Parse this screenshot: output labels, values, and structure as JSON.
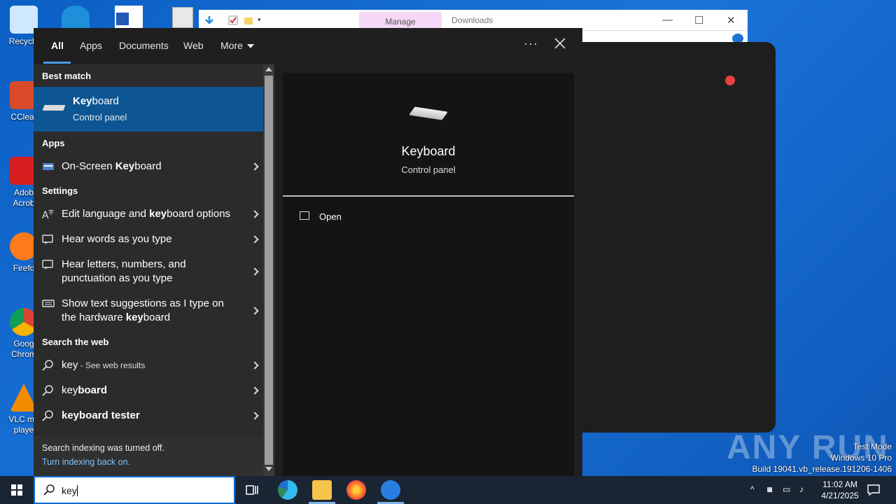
{
  "desktop": {
    "icons": [
      {
        "label": "Recycle",
        "color": "#9fd4ff"
      },
      {
        "label": "CClear",
        "color": "#d84a2a"
      },
      {
        "label": "Adob\nAcrob",
        "color": "#d81f1f"
      },
      {
        "label": "Firefo",
        "color": "#ff7a1a"
      },
      {
        "label": "Goog\nChrom",
        "color": "#2fa84f"
      },
      {
        "label": "VLC me\nplaye",
        "color": "#f28b00"
      }
    ]
  },
  "explorer": {
    "manage_label": "Manage",
    "location": "Downloads"
  },
  "search": {
    "tabs": [
      {
        "label": "All"
      },
      {
        "label": "Apps"
      },
      {
        "label": "Documents"
      },
      {
        "label": "Web"
      },
      {
        "label": "More"
      }
    ],
    "best_match_heading": "Best match",
    "best_match": {
      "title_bold": "Key",
      "title_rest": "board",
      "subtitle": "Control panel"
    },
    "apps_heading": "Apps",
    "apps": [
      {
        "pre": "On-Screen ",
        "bold": "Key",
        "post": "board"
      }
    ],
    "settings_heading": "Settings",
    "settings": [
      {
        "line1_pre": "Edit language and ",
        "line1_bold": "key",
        "line1_post": "board options",
        "line2_pre": "",
        "line2_bold": "",
        "line2_post": ""
      },
      {
        "line1_pre": "Hear words as you type",
        "line1_bold": "",
        "line1_post": "",
        "line2_pre": "",
        "line2_bold": "",
        "line2_post": ""
      },
      {
        "line1_pre": "Hear letters, numbers, and",
        "line1_bold": "",
        "line1_post": "",
        "line2_pre": "punctuation as you type",
        "line2_bold": "",
        "line2_post": ""
      },
      {
        "line1_pre": "Show text suggestions as I type on",
        "line1_bold": "",
        "line1_post": "",
        "line2_pre": "the hardware ",
        "line2_bold": "key",
        "line2_post": "board"
      }
    ],
    "web_heading": "Search the web",
    "web": [
      {
        "bold": "key",
        "post": "",
        "sub": " - See web results"
      },
      {
        "bold": "key",
        "post": "board",
        "sub": ""
      },
      {
        "bold": "keyboard tester",
        "post": "",
        "sub": ""
      }
    ],
    "footer_line1": "Search indexing was turned off.",
    "footer_link": "Turn indexing back on.",
    "preview": {
      "title": "Keyboard",
      "subtitle": "Control panel",
      "action_open": "Open"
    },
    "query": "key"
  },
  "watermark": {
    "brand": "ANY RUN",
    "line1": "Test Mode",
    "line2": "Windows 10 Pro",
    "line3": "Build 19041.vb_release.191206-1406"
  },
  "taskbar": {
    "time": "11:02 AM",
    "date": "4/21/2025"
  },
  "colors": {
    "accent": "#0e5693",
    "link": "#7cc3ff",
    "taskbar": "#1a2533"
  }
}
